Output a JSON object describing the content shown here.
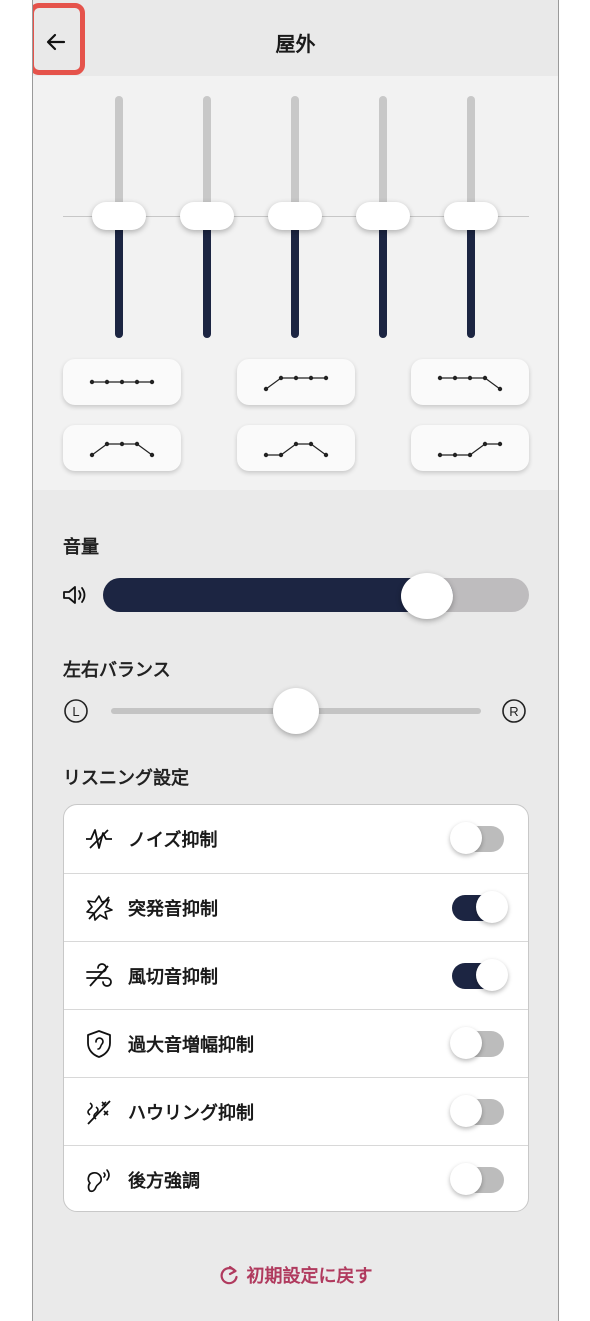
{
  "header": {
    "title": "屋外",
    "back_label": "戻る"
  },
  "equalizer": {
    "bands": [
      {
        "level": 0.5
      },
      {
        "level": 0.5
      },
      {
        "level": 0.5
      },
      {
        "level": 0.5
      },
      {
        "level": 0.5
      }
    ],
    "presets": [
      {
        "icon": "preset-flat-icon",
        "curve": [
          0,
          0,
          0,
          0,
          0
        ]
      },
      {
        "icon": "preset-bass-rise-icon",
        "curve": [
          1,
          0,
          0,
          0,
          0
        ]
      },
      {
        "icon": "preset-treble-drop-icon",
        "curve": [
          0,
          0,
          0,
          0,
          1
        ]
      },
      {
        "icon": "preset-mid-boost-icon",
        "curve": [
          1,
          0,
          0,
          0,
          1
        ]
      },
      {
        "icon": "preset-mid-peak-icon",
        "curve": [
          1,
          1,
          0,
          1,
          1
        ]
      },
      {
        "icon": "preset-treble-rise-icon",
        "curve": [
          1,
          1,
          1,
          0,
          0
        ]
      }
    ]
  },
  "volume": {
    "label": "音量",
    "value_percent": 76,
    "icon": "speaker-icon"
  },
  "balance": {
    "label": "左右バランス",
    "left": "L",
    "right": "R",
    "value_percent": 50
  },
  "listening": {
    "label": "リスニング設定",
    "items": [
      {
        "label": "ノイズ抑制",
        "icon": "noise-icon",
        "on": false
      },
      {
        "label": "突発音抑制",
        "icon": "sudden-sound-icon",
        "on": true
      },
      {
        "label": "風切音抑制",
        "icon": "wind-icon",
        "on": true
      },
      {
        "label": "過大音増幅抑制",
        "icon": "ear-shield-icon",
        "on": false
      },
      {
        "label": "ハウリング抑制",
        "icon": "howling-icon",
        "on": false
      },
      {
        "label": "後方強調",
        "icon": "rear-emphasis-icon",
        "on": false
      }
    ]
  },
  "reset": {
    "label": "初期設定に戻す"
  },
  "colors": {
    "accent": "#1c2542",
    "reset": "#b03a5e",
    "toggle_off": "#bcbcbc"
  }
}
